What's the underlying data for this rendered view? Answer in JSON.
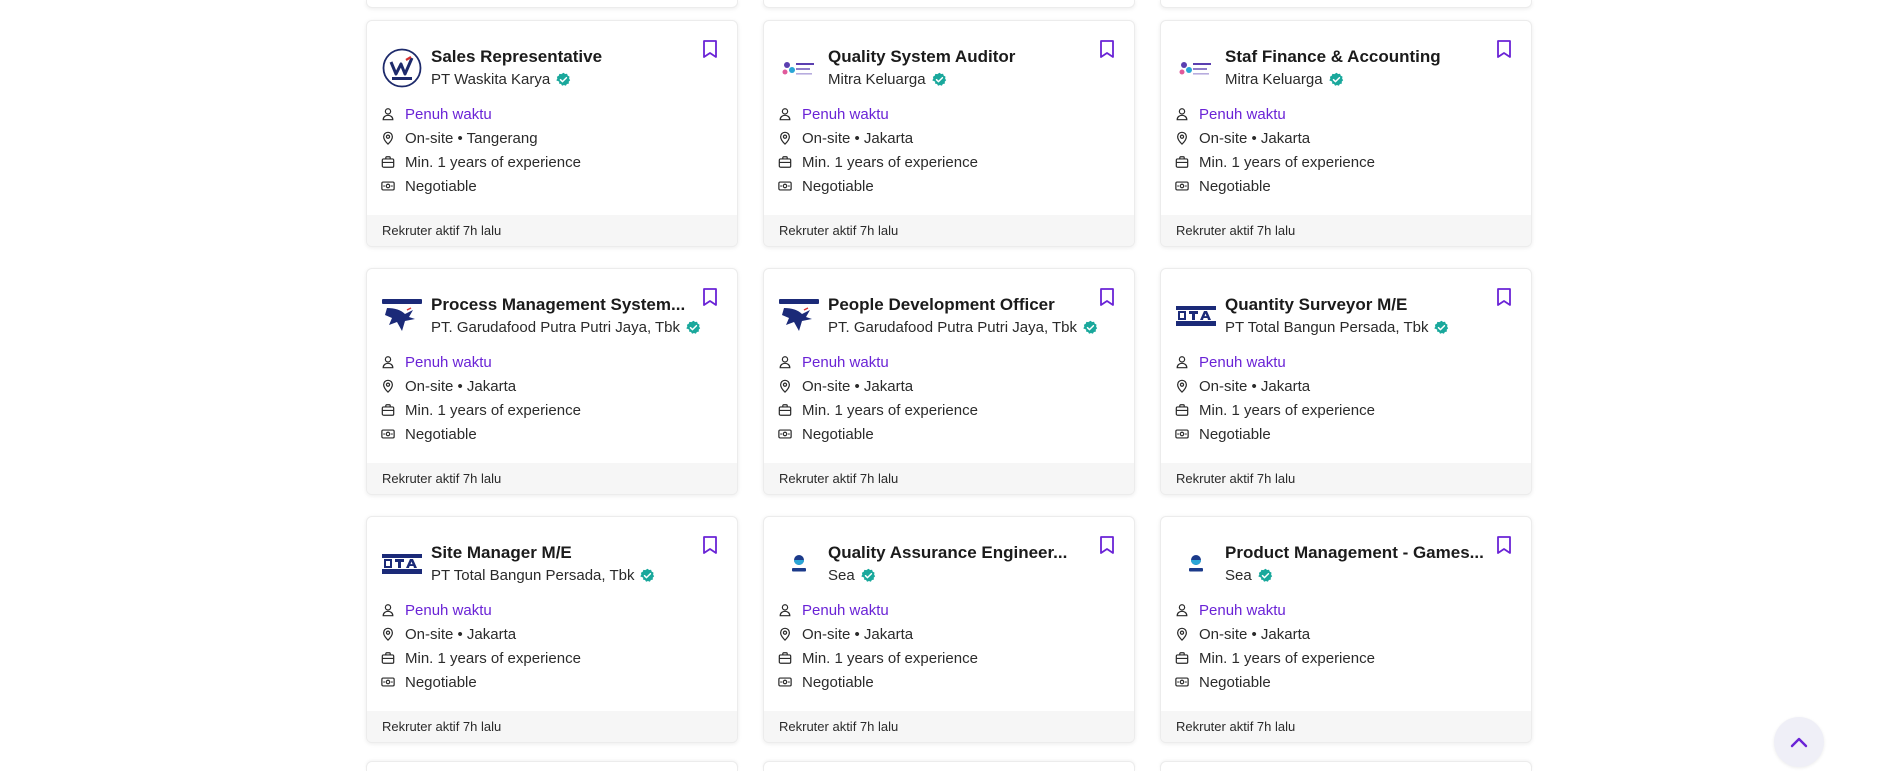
{
  "info_icons": {
    "employment": "person-icon",
    "location": "location-pin-icon",
    "experience": "briefcase-icon",
    "salary": "money-icon"
  },
  "colors": {
    "accent": "#6a23d6",
    "verified": "#1aa89c",
    "footer_bg": "#f6f6f6"
  },
  "jobs": [
    {
      "title": "Sales Representative",
      "company": "PT Waskita Karya",
      "logo": "waskita-logo",
      "employment": "Penuh waktu",
      "location": "On-site • Tangerang",
      "experience": "Min. 1 years of experience",
      "salary": "Negotiable",
      "recruiter": "Rekruter aktif 7h lalu"
    },
    {
      "title": "Quality System Auditor",
      "company": "Mitra Keluarga",
      "logo": "mitra-keluarga-logo",
      "employment": "Penuh waktu",
      "location": "On-site • Jakarta",
      "experience": "Min. 1 years of experience",
      "salary": "Negotiable",
      "recruiter": "Rekruter aktif 7h lalu"
    },
    {
      "title": "Staf Finance & Accounting",
      "company": "Mitra Keluarga",
      "logo": "mitra-keluarga-logo",
      "employment": "Penuh waktu",
      "location": "On-site • Jakarta",
      "experience": "Min. 1 years of experience",
      "salary": "Negotiable",
      "recruiter": "Rekruter aktif 7h lalu"
    },
    {
      "title": "Process Management System...",
      "company": "PT. Garudafood Putra Putri Jaya, Tbk",
      "logo": "garudafood-logo",
      "employment": "Penuh waktu",
      "location": "On-site • Jakarta",
      "experience": "Min. 1 years of experience",
      "salary": "Negotiable",
      "recruiter": "Rekruter aktif 7h lalu"
    },
    {
      "title": "People Development Officer",
      "company": "PT. Garudafood Putra Putri Jaya, Tbk",
      "logo": "garudafood-logo",
      "employment": "Penuh waktu",
      "location": "On-site • Jakarta",
      "experience": "Min. 1 years of experience",
      "salary": "Negotiable",
      "recruiter": "Rekruter aktif 7h lalu"
    },
    {
      "title": "Quantity Surveyor M/E",
      "company": "PT Total Bangun Persada, Tbk",
      "logo": "total-bangun-persada-logo",
      "employment": "Penuh waktu",
      "location": "On-site • Jakarta",
      "experience": "Min. 1 years of experience",
      "salary": "Negotiable",
      "recruiter": "Rekruter aktif 7h lalu"
    },
    {
      "title": "Site Manager M/E",
      "company": "PT Total Bangun Persada, Tbk",
      "logo": "total-bangun-persada-logo",
      "employment": "Penuh waktu",
      "location": "On-site • Jakarta",
      "experience": "Min. 1 years of experience",
      "salary": "Negotiable",
      "recruiter": "Rekruter aktif 7h lalu"
    },
    {
      "title": "Quality Assurance Engineer...",
      "company": "Sea",
      "logo": "sea-logo",
      "employment": "Penuh waktu",
      "location": "On-site • Jakarta",
      "experience": "Min. 1 years of experience",
      "salary": "Negotiable",
      "recruiter": "Rekruter aktif 7h lalu"
    },
    {
      "title": "Product Management - Games...",
      "company": "Sea",
      "logo": "sea-logo",
      "employment": "Penuh waktu",
      "location": "On-site • Jakarta",
      "experience": "Min. 1 years of experience",
      "salary": "Negotiable",
      "recruiter": "Rekruter aktif 7h lalu"
    }
  ],
  "scroll_top": {
    "icon": "chevron-up-icon"
  }
}
